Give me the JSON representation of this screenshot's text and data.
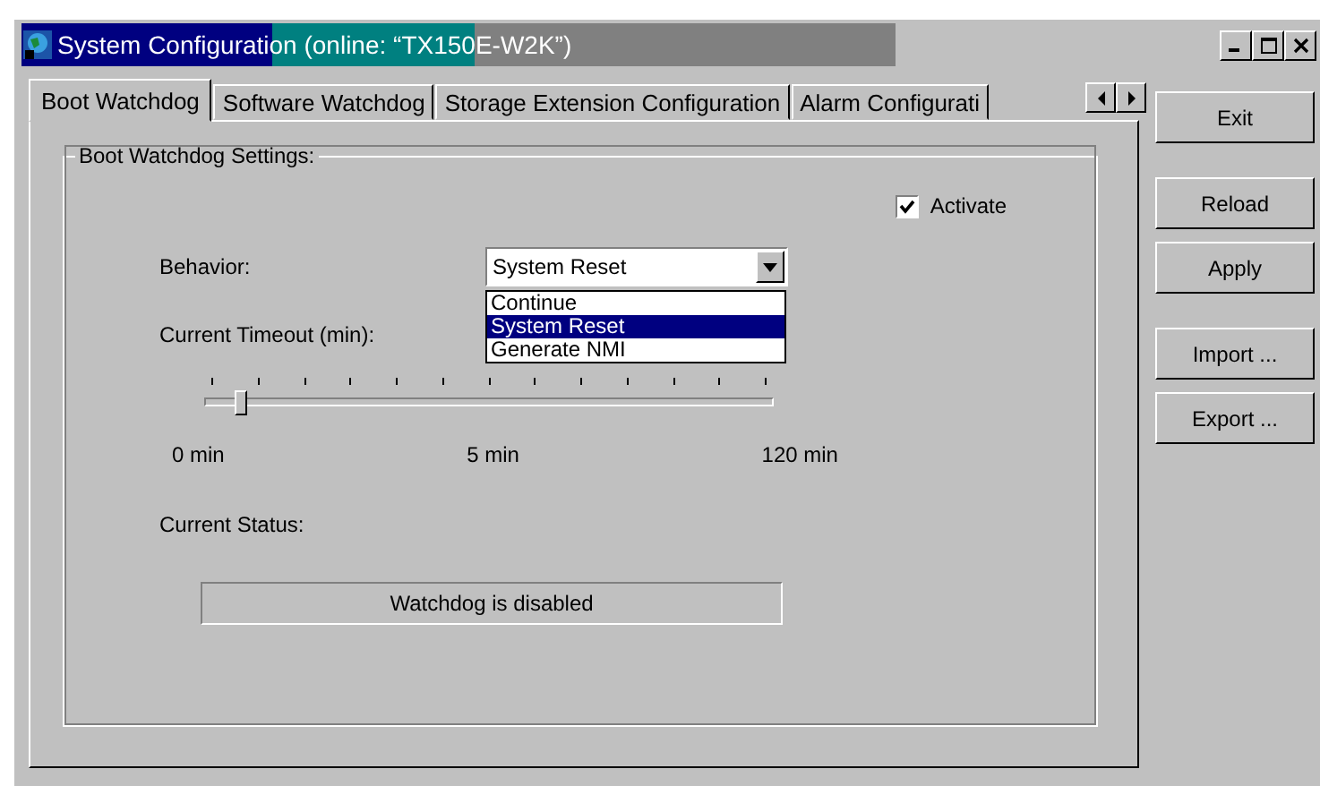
{
  "window": {
    "title": "System Configuration  (online: “TX150E-W2K”)"
  },
  "tabs": [
    {
      "label": "Boot Watchdog",
      "selected": true
    },
    {
      "label": "Software Watchdog",
      "selected": false
    },
    {
      "label": "Storage Extension Configuration",
      "selected": false
    },
    {
      "label": "Alarm Configurati",
      "selected": false
    }
  ],
  "group": {
    "title": "Boot Watchdog Settings:"
  },
  "activate": {
    "label": "Activate",
    "checked": true
  },
  "behavior": {
    "label": "Behavior:",
    "value": "System Reset",
    "expanded": true,
    "options": [
      {
        "label": "Continue",
        "selected": false
      },
      {
        "label": "System Reset",
        "selected": true
      },
      {
        "label": "Generate NMI",
        "selected": false
      }
    ]
  },
  "timeout": {
    "label": "Current Timeout (min):",
    "level": 0.05,
    "ticks": [
      "0 min",
      "5 min",
      "120 min"
    ]
  },
  "status": {
    "label": "Current Status:",
    "value": "Watchdog is disabled"
  },
  "button_groups": [
    [
      "Exit"
    ],
    [
      "Reload",
      "Apply"
    ],
    [
      "Import ...",
      "Export ..."
    ]
  ]
}
